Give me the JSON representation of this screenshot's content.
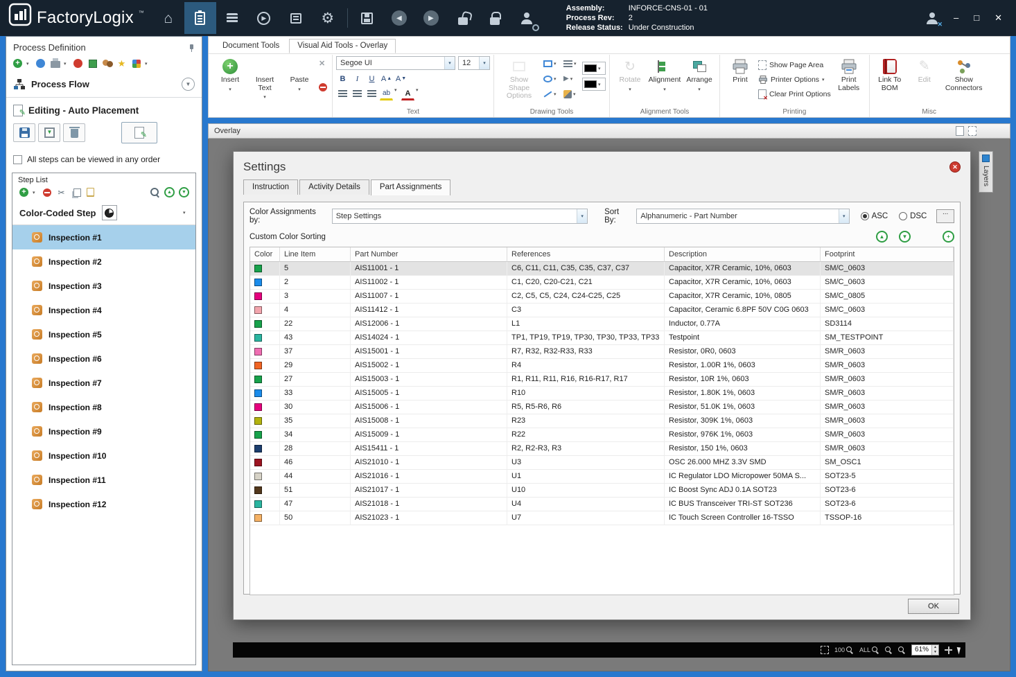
{
  "icons": {
    "caret": "▾",
    "home": "⌂",
    "gear": "⚙",
    "pencil": "✎",
    "scissors": "✂",
    "star": "★",
    "back": "◀",
    "forward": "▶",
    "up": "▲",
    "down": "▼",
    "plus": "+",
    "minus": "−",
    "x": "✕",
    "minimize": "–",
    "maximize": "□",
    "bold": "B",
    "italic": "I",
    "underline": "U",
    "letter_a": "A",
    "rotate": "↻",
    "dots": "..."
  },
  "titlebar": {
    "app_name": "FactoryLogix",
    "trademark": "™",
    "assembly_label": "Assembly:",
    "assembly_value": "INFORCE-CNS-01 - 01",
    "process_rev_label": "Process Rev:",
    "process_rev_value": "2",
    "release_label": "Release Status:",
    "release_value": "Under Construction"
  },
  "sidebar": {
    "title": "Process Definition",
    "process_flow": "Process Flow",
    "editing_mode": "Editing - Auto Placement",
    "order_checkbox": "All steps can be viewed in any order",
    "step_list_title": "Step List",
    "color_coded": "Color-Coded Step",
    "steps": [
      {
        "label": "Inspection #1",
        "selected": true
      },
      {
        "label": "Inspection #2"
      },
      {
        "label": "Inspection #3"
      },
      {
        "label": "Inspection #4"
      },
      {
        "label": "Inspection #5"
      },
      {
        "label": "Inspection #6"
      },
      {
        "label": "Inspection #7"
      },
      {
        "label": "Inspection #8"
      },
      {
        "label": "Inspection #9"
      },
      {
        "label": "Inspection #10"
      },
      {
        "label": "Inspection #11"
      },
      {
        "label": "Inspection #12"
      }
    ]
  },
  "ribbon": {
    "tabs": [
      {
        "label": "Document Tools"
      },
      {
        "label": "Visual Aid Tools - Overlay",
        "selected": true
      }
    ],
    "insert": "Insert",
    "insert_text": "Insert Text",
    "paste": "Paste",
    "font_name": "Segoe UI",
    "font_size": "12",
    "text_label": "Text",
    "show_shape_options": "Show Shape Options",
    "drawing_label": "Drawing Tools",
    "rotate": "Rotate",
    "alignment": "Alignment",
    "arrange": "Arrange",
    "alignment_label": "Alignment Tools",
    "print": "Print",
    "show_page_area": "Show Page Area",
    "printer_options": "Printer Options",
    "clear_print_options": "Clear Print Options",
    "print_labels": "Print Labels",
    "printing_label": "Printing",
    "link_to_bom": "Link To BOM",
    "edit": "Edit",
    "show_connectors": "Show Connectors",
    "misc_label": "Misc"
  },
  "overlay": {
    "title": "Overlay"
  },
  "canvas": {
    "layers_label": "Layers",
    "zoom_100": "100",
    "zoom_all": "ALL",
    "zoom_value": "61%"
  },
  "dialog": {
    "title": "Settings",
    "tabs": [
      {
        "label": "Instruction"
      },
      {
        "label": "Activity Details"
      },
      {
        "label": "Part Assignments",
        "selected": true
      }
    ],
    "color_by_label": "Color Assignments by:",
    "color_by_value": "Step Settings",
    "sort_by_label": "Sort By:",
    "sort_by_value": "Alphanumeric - Part Number",
    "asc": "ASC",
    "dsc": "DSC",
    "custom_sorting": "Custom Color Sorting",
    "ok": "OK",
    "table": {
      "columns": [
        "Color",
        "Line Item",
        "Part Number",
        "References",
        "Description",
        "Footprint"
      ],
      "rows": [
        {
          "color": "#17a24b",
          "line": "5",
          "part": "AIS11001 - 1",
          "refs": "C6, C11, C11, C35, C35, C37, C37",
          "desc": "Capacitor,  X7R Ceramic, 10%, 0603",
          "footprint": "SM/C_0603",
          "selected": true
        },
        {
          "color": "#1b8ceb",
          "line": "2",
          "part": "AIS11002 - 1",
          "refs": "C1, C20, C20-C21, C21",
          "desc": "Capacitor,  X7R Ceramic, 10%, 0603",
          "footprint": "SM/C_0603"
        },
        {
          "color": "#e6007e",
          "line": "3",
          "part": "AIS11007 - 1",
          "refs": "C2, C5, C5, C24, C24-C25, C25",
          "desc": "Capacitor,  X7R Ceramic, 10%, 0805",
          "footprint": "SM/C_0805"
        },
        {
          "color": "#f2a5ad",
          "line": "4",
          "part": "AIS11412 - 1",
          "refs": "C3",
          "desc": "Capacitor, Ceramic 6.8PF 50V C0G 0603",
          "footprint": "SM/C_0603"
        },
        {
          "color": "#17a24b",
          "line": "22",
          "part": "AIS12006 - 1",
          "refs": "L1",
          "desc": "Inductor, 0.77A",
          "footprint": "SD3114"
        },
        {
          "color": "#2ab5a0",
          "line": "43",
          "part": "AIS14024 - 1",
          "refs": "TP1, TP19, TP19, TP30, TP30, TP33, TP33",
          "desc": "Testpoint",
          "footprint": "SM_TESTPOINT"
        },
        {
          "color": "#ef6eb2",
          "line": "37",
          "part": "AIS15001 - 1",
          "refs": "R7, R32, R32-R33, R33",
          "desc": "Resistor, 0R0, 0603",
          "footprint": "SM/R_0603"
        },
        {
          "color": "#f06423",
          "line": "29",
          "part": "AIS15002 - 1",
          "refs": "R4",
          "desc": "Resistor, 1.00R 1%, 0603",
          "footprint": "SM/R_0603"
        },
        {
          "color": "#17a24b",
          "line": "27",
          "part": "AIS15003 - 1",
          "refs": "R1, R11, R11, R16, R16-R17, R17",
          "desc": "Resistor, 10R 1%, 0603",
          "footprint": "SM/R_0603"
        },
        {
          "color": "#1b8ceb",
          "line": "33",
          "part": "AIS15005 - 1",
          "refs": "R10",
          "desc": "Resistor, 1.80K 1%, 0603",
          "footprint": "SM/R_0603"
        },
        {
          "color": "#e6007e",
          "line": "30",
          "part": "AIS15006 - 1",
          "refs": "R5, R5-R6, R6",
          "desc": "Resistor, 51.0K 1%, 0603",
          "footprint": "SM/R_0603"
        },
        {
          "color": "#b3b30e",
          "line": "35",
          "part": "AIS15008 - 1",
          "refs": "R23",
          "desc": "Resistor, 309K 1%, 0603",
          "footprint": "SM/R_0603"
        },
        {
          "color": "#17a24b",
          "line": "34",
          "part": "AIS15009 - 1",
          "refs": "R22",
          "desc": "Resistor, 976K 1%, 0603",
          "footprint": "SM/R_0603"
        },
        {
          "color": "#1c3e6e",
          "line": "28",
          "part": "AIS15411 - 1",
          "refs": "R2, R2-R3, R3",
          "desc": "Resistor, 150 1%, 0603",
          "footprint": "SM/R_0603"
        },
        {
          "color": "#9c1320",
          "line": "46",
          "part": "AIS21010 - 1",
          "refs": "U3",
          "desc": "OSC 26.000 MHZ 3.3V SMD",
          "footprint": "SM_OSC1"
        },
        {
          "color": "#d6d2c6",
          "line": "44",
          "part": "AIS21016 - 1",
          "refs": "U1",
          "desc": "IC Regulator LDO Micropower 50MA S...",
          "footprint": "SOT23-5"
        },
        {
          "color": "#52371c",
          "line": "51",
          "part": "AIS21017 - 1",
          "refs": "U10",
          "desc": "IC Boost Sync ADJ 0.1A SOT23",
          "footprint": "SOT23-6"
        },
        {
          "color": "#2ab5a0",
          "line": "47",
          "part": "AIS21018 - 1",
          "refs": "U4",
          "desc": "IC BUS Transceiver TRI-ST SOT236",
          "footprint": "SOT23-6"
        },
        {
          "color": "#f5b164",
          "line": "50",
          "part": "AIS21023 - 1",
          "refs": "U7",
          "desc": "IC Touch Screen Controller 16-TSSO",
          "footprint": "TSSOP-16"
        }
      ]
    }
  }
}
